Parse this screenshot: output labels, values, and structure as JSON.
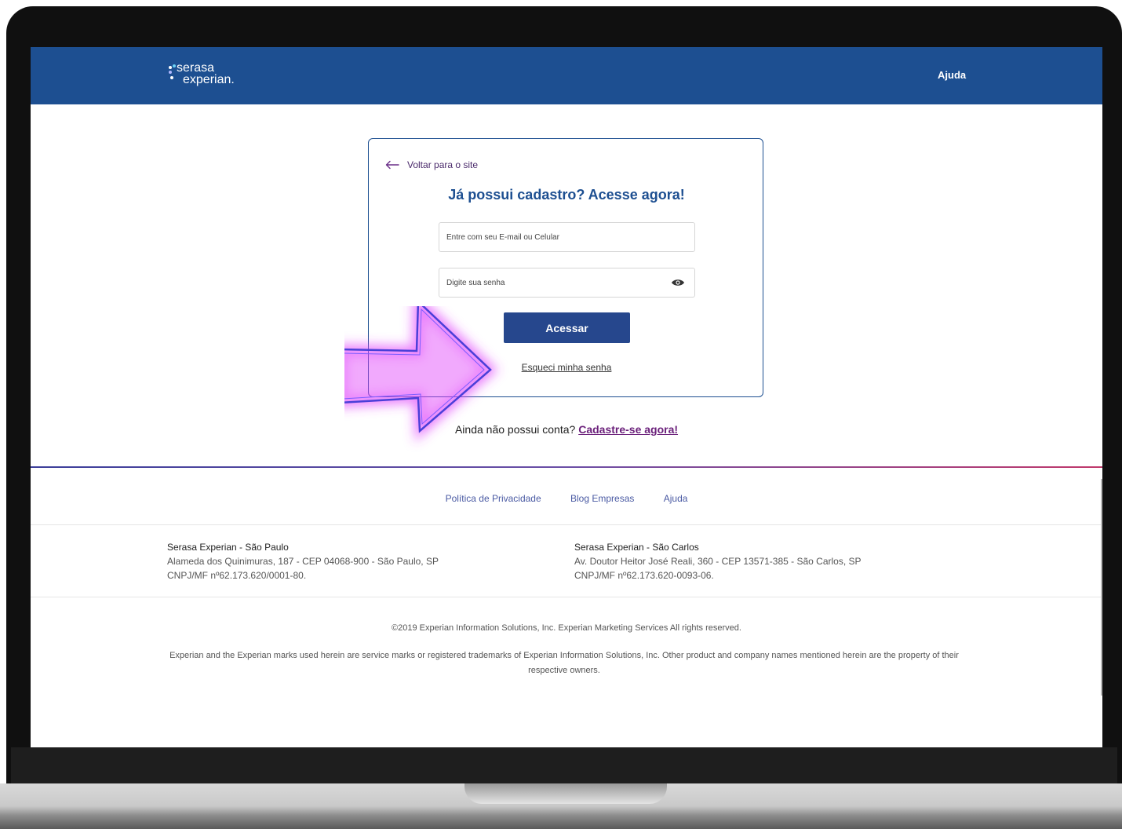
{
  "header": {
    "logo_word_1": "serasa",
    "logo_word_2": "experian.",
    "logo_dot_colors": [
      "#ffffff",
      "#6ad1f5",
      "#b0b8ff",
      "#ffffff"
    ],
    "help_label": "Ajuda"
  },
  "login": {
    "back_label": "Voltar para o site",
    "title": "Já possui cadastro? Acesse agora!",
    "email_placeholder": "Entre com seu E-mail ou Celular",
    "password_placeholder": "Digite sua senha",
    "password_toggle_icon": "eye-icon",
    "submit_label": "Acessar",
    "forgot_label": "Esqueci minha senha"
  },
  "signup": {
    "prompt": "Ainda não possui conta?",
    "link_label": "Cadastre-se agora!"
  },
  "footer": {
    "links": [
      "Política de Privacidade",
      "Blog Empresas",
      "Ajuda"
    ],
    "offices": [
      {
        "name": "Serasa Experian - São Paulo",
        "address": "Alameda dos Quinimuras, 187 - CEP 04068-900 - São Paulo, SP",
        "cnpj": "CNPJ/MF nº62.173.620/0001-80."
      },
      {
        "name": "Serasa Experian - São Carlos",
        "address": "Av. Doutor Heitor José Reali, 360 - CEP 13571-385 - São Carlos, SP",
        "cnpj": "CNPJ/MF nº62.173.620-0093-06."
      }
    ],
    "copyright": "©2019 Experian Information Solutions, Inc. Experian Marketing Services All rights reserved.",
    "legal": "Experian and the Experian marks used herein are service marks or registered trademarks of Experian Information Solutions, Inc. Other product and company names mentioned herein are the property of their respective owners."
  },
  "colors": {
    "header_bg": "#1d4f91",
    "button_bg": "#26478d",
    "signup_link": "#6a1f7a",
    "annotation_glow": "#e040fb"
  }
}
